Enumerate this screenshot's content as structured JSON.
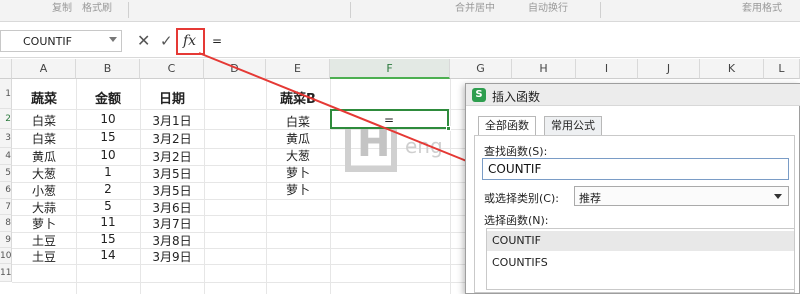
{
  "ribbon": {
    "fragments": [
      "复制",
      "格式刷",
      "自动换行",
      "套用格式",
      "合并居中",
      "自动换行"
    ]
  },
  "formula_bar": {
    "name_box": "COUNTIF",
    "cancel_symbol": "✕",
    "confirm_symbol": "✓",
    "fx_label": "fx",
    "formula": "="
  },
  "columns": [
    "A",
    "B",
    "C",
    "D",
    "E",
    "F",
    "G",
    "H",
    "I",
    "J",
    "K",
    "L"
  ],
  "active_column": "F",
  "rows": [
    "1",
    "2",
    "3",
    "4",
    "5",
    "6",
    "7",
    "8",
    "9",
    "10",
    "11"
  ],
  "table": {
    "headers": [
      "蔬菜",
      "金额",
      "日期"
    ],
    "rows": [
      [
        "白菜",
        "10",
        "3月1日"
      ],
      [
        "白菜",
        "15",
        "3月2日"
      ],
      [
        "黄瓜",
        "10",
        "3月2日"
      ],
      [
        "大葱",
        "1",
        "3月5日"
      ],
      [
        "小葱",
        "2",
        "3月5日"
      ],
      [
        "大蒜",
        "5",
        "3月6日"
      ],
      [
        "萝卜",
        "11",
        "3月7日"
      ],
      [
        "土豆",
        "15",
        "3月8日"
      ],
      [
        "土豆",
        "14",
        "3月9日"
      ]
    ]
  },
  "criteria": {
    "header": "蔬菜B",
    "items": [
      "白菜",
      "黄瓜",
      "大葱",
      "萝卜",
      "萝卜"
    ]
  },
  "active_cell_value": "=",
  "watermark": {
    "letter": "H",
    "text": "eng"
  },
  "dialog": {
    "title": "插入函数",
    "logo": "S",
    "tabs": [
      "全部函数",
      "常用公式"
    ],
    "search_label": "查找函数(S):",
    "search_value": "COUNTIF",
    "category_label": "或选择类别(C):",
    "category_value": "推荐",
    "function_label": "选择函数(N):",
    "functions": [
      "COUNTIF",
      "COUNTIFS"
    ]
  },
  "colors": {
    "accent": "#2e8b3c",
    "highlight": "#e53935"
  }
}
